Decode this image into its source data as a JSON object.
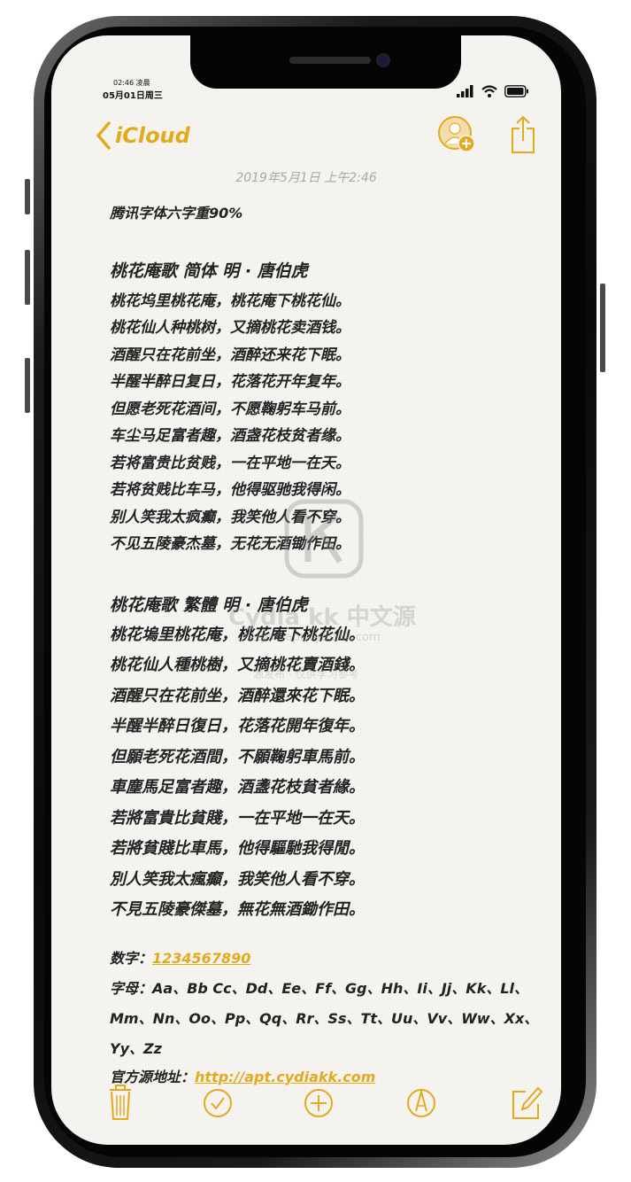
{
  "status_bar": {
    "time": "02:46 凌晨",
    "date": "05月01日周三"
  },
  "nav": {
    "back_label": "iCloud",
    "add_person_icon": "add-person-icon",
    "share_icon": "share-icon"
  },
  "note": {
    "date": "2019年5月1日 上午2:46",
    "title": "腾讯字体六字重90%",
    "section1": {
      "heading": "桃花庵歌  简体   明 · 唐伯虎",
      "lines": [
        "桃花坞里桃花庵，桃花庵下桃花仙。",
        "桃花仙人种桃树，又摘桃花卖酒钱。",
        "酒醒只在花前坐，酒醉还来花下眠。",
        "半醒半醉日复日，花落花开年复年。",
        "但愿老死花酒间，不愿鞠躬车马前。",
        "车尘马足富者趣，酒盏花枝贫者缘。",
        "若将富贵比贫贱，一在平地一在天。",
        "若将贫贱比车马，他得驱驰我得闲。",
        "别人笑我太疯癫，我笑他人看不穿。",
        "不见五陵豪杰墓，无花无酒锄作田。"
      ]
    },
    "section2": {
      "heading": "桃花庵歌  繁體      明 · 唐伯虎",
      "lines": [
        "桃花塢里桃花庵，桃花庵下桃花仙。",
        "桃花仙人種桃樹，又摘桃花賣酒錢。",
        "酒醒只在花前坐，酒醉還來花下眠。",
        "半醒半醉日復日，花落花開年復年。",
        "但願老死花酒間，不願鞠躬車馬前。",
        "車塵馬足富者趣，酒盞花枝貧者緣。",
        "若將富貴比貧賤，一在平地一在天。",
        "若將貧賤比車馬，他得驅馳我得閒。",
        "別人笑我太瘋癲，我笑他人看不穿。",
        "不見五陵豪傑墓，無花無酒鋤作田。"
      ]
    },
    "digits_label": "数字：",
    "digits_value": "1234567890",
    "letters_label": "字母：",
    "letters_line1": "Aa、Bb Cc、Dd、Ee、Ff、Gg、Hh、Ii、Jj、Kk、Ll、",
    "letters_line2": "Mm、Nn、Oo、Pp、Qq、Rr、Ss、Tt、Uu、Vv、Ww、Xx、",
    "letters_line3": "Yy、Zz",
    "source_label": "官方源地址：",
    "source_url": "http://apt.cydiakk.com"
  },
  "watermark": {
    "text": "Cydia kk 中文源",
    "url": "https://apt.cydiakk.com",
    "sub": "源发布 · 仅供学习参考"
  },
  "toolbar": {
    "icons": [
      "trash-icon",
      "checklist-icon",
      "add-icon",
      "markup-icon",
      "compose-icon"
    ]
  },
  "colors": {
    "accent": "#e3aa1c",
    "paper": "#f6f5f1",
    "text": "#222222"
  }
}
